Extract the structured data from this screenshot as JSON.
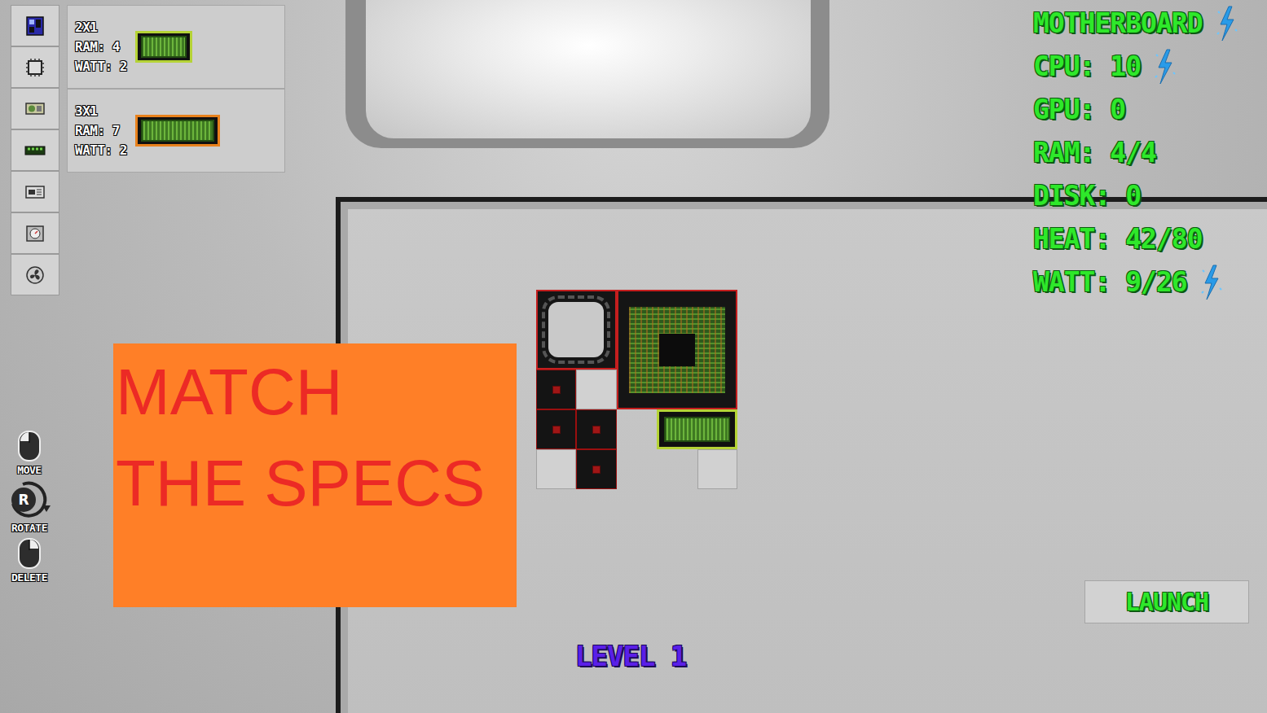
{
  "parts": [
    {
      "size": "2X1",
      "ram": "RAM: 4",
      "watt": "WATT: 2",
      "kind": "small",
      "color": "#b5d336"
    },
    {
      "size": "3X1",
      "ram": "RAM: 7",
      "watt": "WATT: 2",
      "kind": "large",
      "color": "#e8811c"
    }
  ],
  "stats": [
    {
      "text": "MOTHERBOARD",
      "boost": true
    },
    {
      "text": "CPU: 10",
      "boost": true
    },
    {
      "text": "GPU: 0",
      "boost": false
    },
    {
      "text": "RAM: 4/4",
      "boost": false
    },
    {
      "text": "DISK: 0",
      "boost": false
    },
    {
      "text": "HEAT: 42/80",
      "boost": false
    },
    {
      "text": "WATT: 9/26",
      "boost": true
    }
  ],
  "controls": [
    {
      "label": "MOVE",
      "kind": "mouse-left"
    },
    {
      "label": "ROTATE",
      "kind": "rotate",
      "key": "R"
    },
    {
      "label": "DELETE",
      "kind": "mouse-right"
    }
  ],
  "banner": [
    "MATCH",
    "THE SPECS"
  ],
  "level": "LEVEL 1",
  "launch": "LAUNCH",
  "board": {
    "cells": [
      [
        "slot",
        "slot",
        "slot",
        "slot",
        "slot"
      ],
      [
        "slot",
        "slot",
        "slot",
        "slot",
        "slot"
      ],
      [
        "power",
        "slot",
        "slot",
        "slot",
        "slot"
      ],
      [
        "power",
        "power",
        "none",
        "slot",
        "slot"
      ],
      [
        "slot",
        "power",
        "none",
        "none",
        "slot"
      ]
    ],
    "pieces": [
      {
        "kind": "socket"
      },
      {
        "kind": "cpu"
      },
      {
        "kind": "ram",
        "color": "#b5d336"
      }
    ]
  }
}
